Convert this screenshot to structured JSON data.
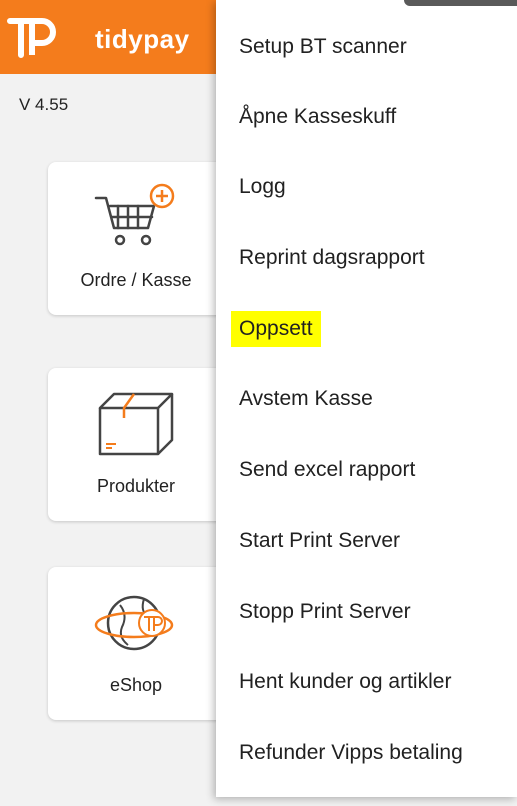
{
  "app": {
    "brand": "tidypay",
    "version": "V 4.55"
  },
  "tiles": [
    {
      "label": "Ordre / Kasse",
      "icon": "cart-add-icon"
    },
    {
      "label": "Produkter",
      "icon": "box-icon"
    },
    {
      "label": "eShop",
      "icon": "globe-logo-icon"
    }
  ],
  "menu": {
    "items": [
      {
        "label": "Setup BT scanner"
      },
      {
        "label": "Åpne Kasseskuff"
      },
      {
        "label": "Logg"
      },
      {
        "label": "Reprint dagsrapport"
      },
      {
        "label": "Oppsett",
        "highlighted": true
      },
      {
        "label": "Avstem Kasse"
      },
      {
        "label": "Send excel rapport"
      },
      {
        "label": "Start Print Server"
      },
      {
        "label": "Stopp Print Server"
      },
      {
        "label": "Hent kunder og artikler"
      },
      {
        "label": "Refunder Vipps betaling"
      }
    ]
  },
  "colors": {
    "brand": "#f47c1c",
    "highlight": "#ffff00"
  }
}
